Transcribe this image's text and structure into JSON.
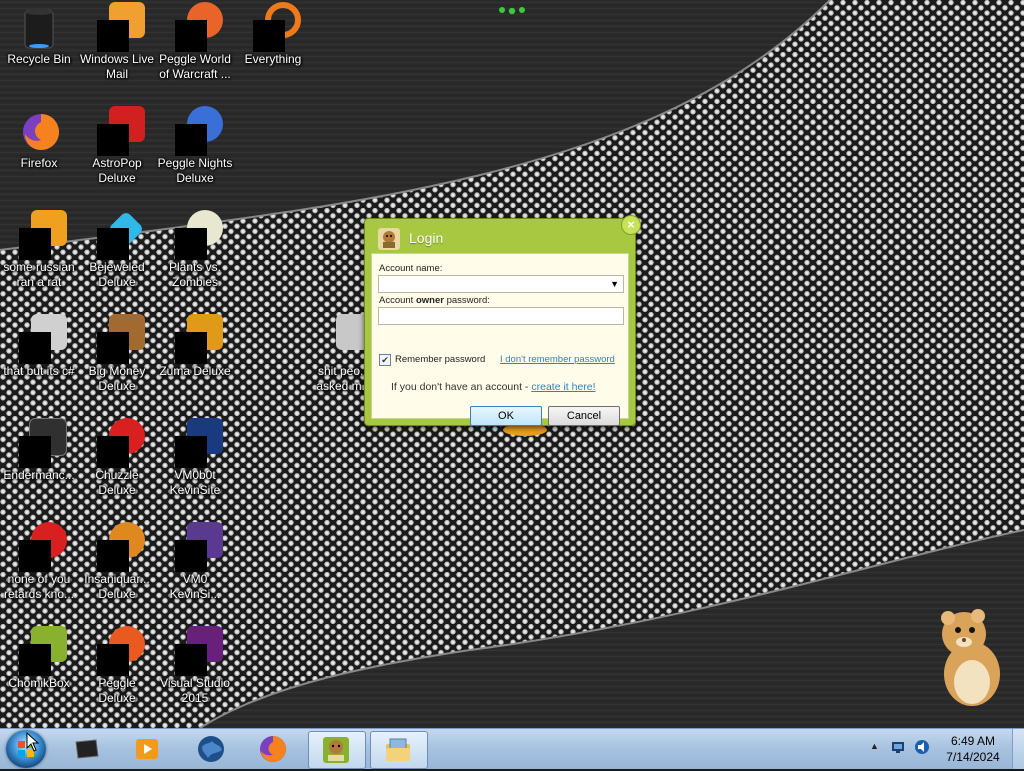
{
  "desktop": {
    "icons": [
      {
        "label": "Recycle Bin",
        "icon": "recycle-bin-icon",
        "color": "#1c1c1c"
      },
      {
        "label": "Windows Live Mail",
        "icon": "windows-live-mail-icon",
        "color": "#f0a030"
      },
      {
        "label": "Peggle World of Warcraft ...",
        "icon": "peggle-wow-icon",
        "color": "#e8642a"
      },
      {
        "label": "Everything",
        "icon": "everything-icon",
        "color": "#f07a18"
      },
      {
        "label": "Firefox",
        "icon": "firefox-icon",
        "color": "#f5821f"
      },
      {
        "label": "AstroPop Deluxe",
        "icon": "astropop-icon",
        "color": "#d02020"
      },
      {
        "label": "Peggle Nights Deluxe",
        "icon": "peggle-nights-icon",
        "color": "#3a6fd8"
      },
      {
        "label": "some russian ran a rat",
        "icon": "document-icon",
        "color": "#f0a020"
      },
      {
        "label": "Bejeweled Deluxe",
        "icon": "bejeweled-icon",
        "color": "#2fb8e8"
      },
      {
        "label": "Plants vs. Zombies",
        "icon": "plants-vs-zombies-icon",
        "color": "#e8e8d0"
      },
      {
        "label": "that but its c#",
        "icon": "document-icon",
        "color": "#d0d0d0"
      },
      {
        "label": "Big Money Deluxe",
        "icon": "big-money-icon",
        "color": "#a06a30"
      },
      {
        "label": "Zuma Deluxe",
        "icon": "zuma-icon",
        "color": "#e09a18"
      },
      {
        "label": "shit peo... asked m...",
        "icon": "document-icon",
        "color": "#c8c8c8"
      },
      {
        "label": "Endermanc...",
        "icon": "endermanch-icon",
        "color": "#303030"
      },
      {
        "label": "Chuzzle Deluxe",
        "icon": "chuzzle-icon",
        "color": "#d82020"
      },
      {
        "label": "VM0b0t KevinSite",
        "icon": "vm-icon",
        "color": "#1a3a80"
      },
      {
        "label": "none of you retards kno...",
        "icon": "shortcut-icon",
        "color": "#d82020"
      },
      {
        "label": "Insaniquar... Deluxe",
        "icon": "insaniquarium-icon",
        "color": "#e08820"
      },
      {
        "label": "VM0 KevinSi...",
        "icon": "vm-icon",
        "color": "#5a3a90"
      },
      {
        "label": "ChomikBox",
        "icon": "chomikbox-icon",
        "color": "#8ab030"
      },
      {
        "label": "Peggle Deluxe",
        "icon": "peggle-deluxe-icon",
        "color": "#e85a20"
      },
      {
        "label": "Visual Studio 2015",
        "icon": "visual-studio-icon",
        "color": "#68217a"
      }
    ]
  },
  "dialog": {
    "title": "Login",
    "close_glyph": "×",
    "account_name_label": "Account name:",
    "password_label_pre": "Account ",
    "password_label_bold": "owner",
    "password_label_post": " password:",
    "account_name_value": "",
    "password_value": "",
    "remember_label": "Remember password",
    "remember_checked": true,
    "forgot_link": "I don't remember password",
    "signup_text": "If you don't have an account - ",
    "signup_link": "create it here!",
    "ok_label": "OK",
    "cancel_label": "Cancel",
    "accent": "#a7c840"
  },
  "taskbar": {
    "pinned": [
      {
        "name": "dark-app-icon",
        "color": "#222"
      },
      {
        "name": "media-player-icon",
        "color": "#f39a1c"
      },
      {
        "name": "globe-icon",
        "color": "#1e4f8a"
      },
      {
        "name": "firefox-icon",
        "color": "#f5821f"
      },
      {
        "name": "chomikbox-icon",
        "color": "#8ab030"
      },
      {
        "name": "windows-explorer-icon",
        "color": "#e8c060"
      }
    ],
    "clock_time": "6:49 AM",
    "clock_date": "7/14/2024"
  }
}
